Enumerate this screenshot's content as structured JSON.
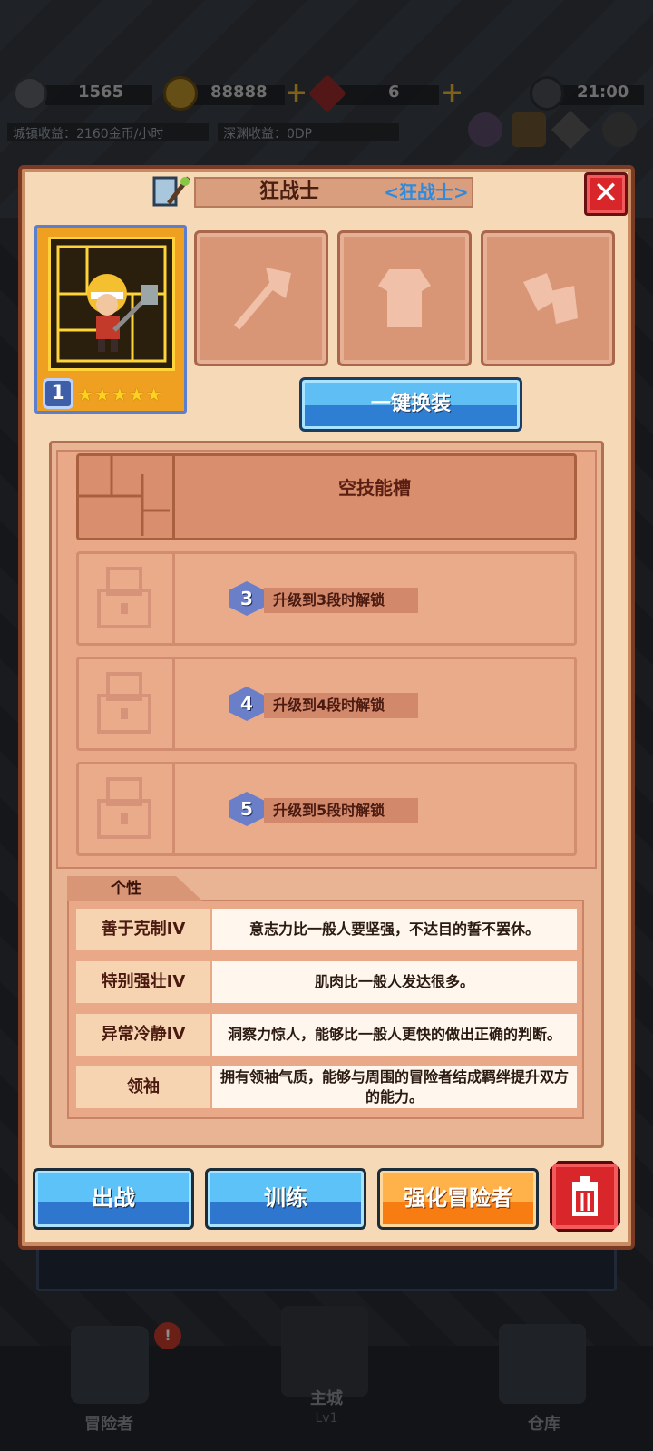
{
  "hud": {
    "energy": "1565",
    "gold": "88888",
    "gems": "6",
    "time": "21:00",
    "town_income": "城镇收益：2160金币/小时",
    "abyss_income": "深渊收益：0DP"
  },
  "panel": {
    "title": "狂战士",
    "subtitle": "<狂战士>",
    "close_label": "✕"
  },
  "hero": {
    "level": "1",
    "stars": "★★★★★"
  },
  "one_key_equip": "一键换装",
  "skills": {
    "empty_slot": "空技能槽",
    "locked": [
      {
        "tier": "3",
        "text": "升级到3段时解锁"
      },
      {
        "tier": "4",
        "text": "升级到4段时解锁"
      },
      {
        "tier": "5",
        "text": "升级到5段时解锁"
      }
    ]
  },
  "personality": {
    "tab_label": "个性",
    "traits": [
      {
        "name": "善于克制IV",
        "desc": "意志力比一般人要坚强，不达目的誓不罢休。"
      },
      {
        "name": "特别强壮IV",
        "desc": "肌肉比一般人发达很多。"
      },
      {
        "name": "异常冷静IV",
        "desc": "洞察力惊人，能够比一般人更快的做出正确的判断。"
      },
      {
        "name": "领袖",
        "desc": "拥有领袖气质，能够与周围的冒险者结成羁绊提升双方的能力。"
      }
    ]
  },
  "actions": {
    "deploy": "出战",
    "train": "训练",
    "enhance": "强化冒险者"
  },
  "bottom_nav": {
    "adventurer": "冒险者",
    "main_city": "主城",
    "main_city_level": "Lv1",
    "warehouse": "仓库"
  },
  "colors": {
    "panel_bg": "#f6d9b7",
    "accent_blue": "#2e7ed4",
    "accent_orange": "#f77c12",
    "danger_red": "#d8262b",
    "subtitle_blue": "#2c8be0"
  }
}
